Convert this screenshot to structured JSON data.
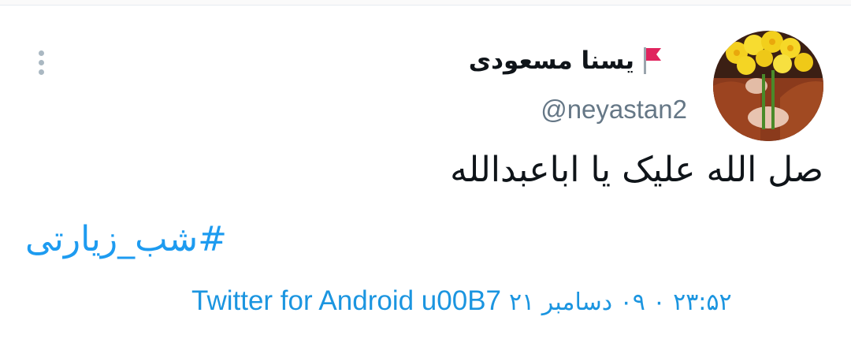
{
  "user": {
    "display_name": "یسنا مسعودی",
    "handle": "@neyastan2",
    "flag_icon": "red-flag-icon",
    "avatar_icon": "daffodil-avatar"
  },
  "tweet": {
    "text": "صل الله علیک یا اباعبدالله",
    "hashtag": "#شب_زیارتی",
    "source": "Twitter for Android u00B7",
    "timestamp": "۲۳:۵۲ ۰ ۰۹ دسامبر ۲۱"
  },
  "colors": {
    "link": "#1d9bf0",
    "muted": "#657786",
    "flag": "#e0245e"
  },
  "menu": {
    "icon": "more-vertical-icon"
  }
}
